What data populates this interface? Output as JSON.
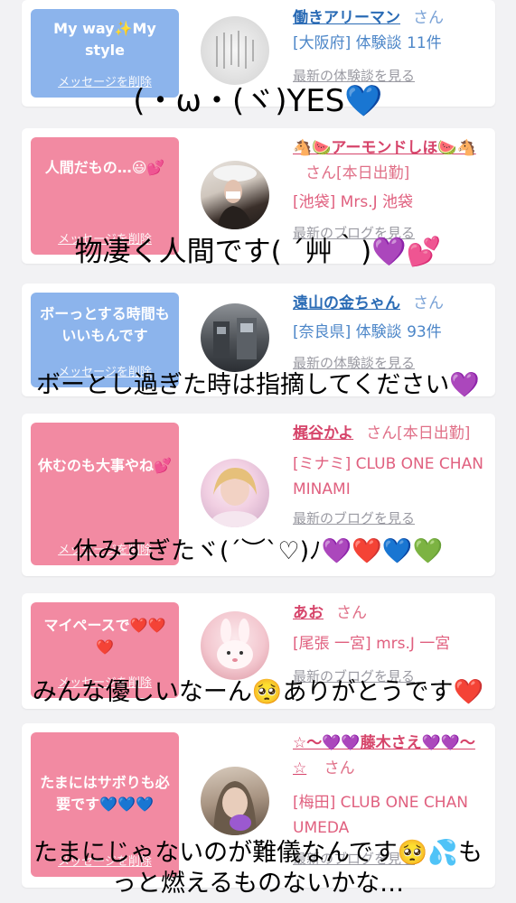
{
  "cards": [
    {
      "color": "blue",
      "message": "My way✨My style",
      "delete_label": "メッセージを削除",
      "name": "働きアリーマン",
      "san": "さん",
      "meta": "[大阪府] 体験談 11件",
      "link": "最新の体験談を見る",
      "avatar_colors": [
        "#e9e9e9",
        "#bdbdbd"
      ]
    },
    {
      "color": "pink",
      "message": "人間だもの…😃💕",
      "delete_label": "メッセージを削除",
      "name": "🐴🍉アーモンドしほ🍉🐴",
      "san": "さん[本日出勤]",
      "meta": "[池袋] Mrs.J 池袋",
      "link": "最新のブログを見る",
      "avatar_colors": [
        "#d8d0c8",
        "#3a2f2a"
      ]
    },
    {
      "color": "blue",
      "message": "ボーっとする時間もいいもんです",
      "delete_label": "メッセージを削除",
      "name": "遠山の金ちゃん",
      "san": "さん",
      "meta": "[奈良県] 体験談 93件",
      "link": "最新の体験談を見る",
      "avatar_colors": [
        "#6b6f74",
        "#2b2e33"
      ]
    },
    {
      "color": "pink",
      "message": "休むのも大事やね💕",
      "delete_label": "メッセージを削除",
      "name": "梶谷かよ",
      "san": "さん[本日出勤]",
      "meta": "[ミナミ] CLUB ONE CHAN MINAMI",
      "link": "最新のブログを見る",
      "avatar_colors": [
        "#f3d7e6",
        "#c9a3c2"
      ]
    },
    {
      "color": "pink",
      "message": "マイペースで❤️❤️❤️",
      "delete_label": "メッセージを削除",
      "name": "あお",
      "san": "さん",
      "meta": "[尾張 一宮] mrs.J 一宮",
      "link": "最新のブログを見る",
      "avatar_colors": [
        "#f7d6dc",
        "#e6a3b0"
      ]
    },
    {
      "color": "pink",
      "message": "たまにはサボりも必要です💙💙💙",
      "delete_label": "メッセージを削除",
      "name": "☆〜💜💜藤木さえ💜💜〜☆",
      "san": "さん",
      "meta": "[梅田] CLUB ONE CHAN UMEDA",
      "link": "最新のブログを見る",
      "avatar_colors": [
        "#c8b9a8",
        "#6a5a4a"
      ]
    }
  ],
  "overlays": [
    "(・ω・(ヾ)YES💙",
    "物凄く人間です( ´艸｀)💜💕",
    "ボーとし過ぎた時は指摘してください💜",
    "休みすぎたヾ(´︶`♡)ﾉ💜❤️💙💚",
    "みんな優しいなーん🥺ありがとうです❤️",
    "たまにじゃないのが難儀なんです🥺💦も",
    "っと燃えるものないかな…"
  ]
}
